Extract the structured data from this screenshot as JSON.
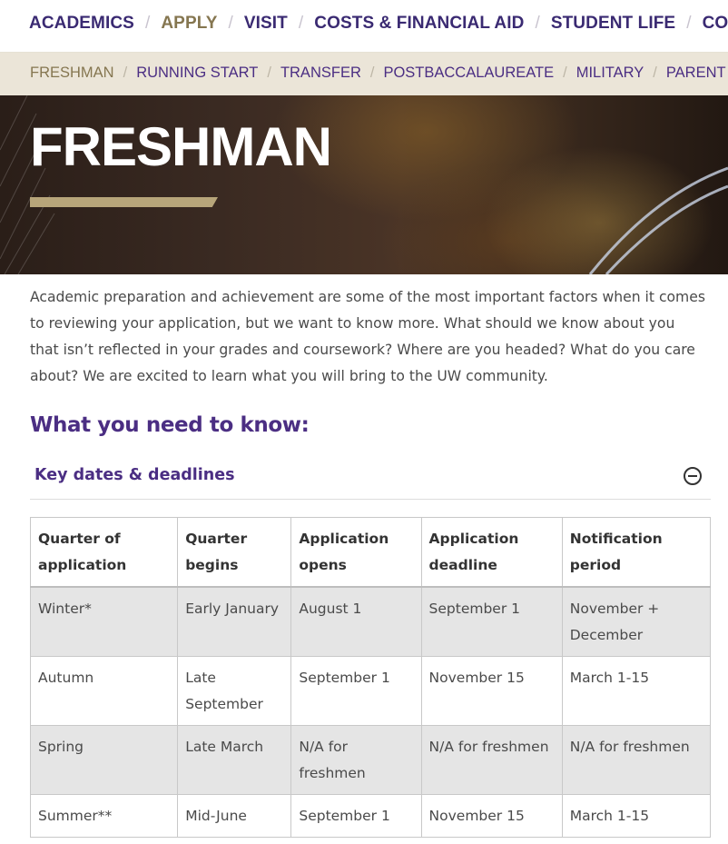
{
  "top_nav": {
    "items": [
      {
        "label": "ACADEMICS",
        "active": false
      },
      {
        "label": "APPLY",
        "active": true
      },
      {
        "label": "VISIT",
        "active": false
      },
      {
        "label": "COSTS & FINANCIAL AID",
        "active": false
      },
      {
        "label": "STUDENT LIFE",
        "active": false
      },
      {
        "label": "CON",
        "active": false
      }
    ],
    "separator": "/"
  },
  "sub_nav": {
    "items": [
      {
        "label": "FRESHMAN",
        "active": true
      },
      {
        "label": "RUNNING START",
        "active": false
      },
      {
        "label": "TRANSFER",
        "active": false
      },
      {
        "label": "POSTBACCALAUREATE",
        "active": false
      },
      {
        "label": "MILITARY",
        "active": false
      },
      {
        "label": "PARENT",
        "active": false
      }
    ],
    "separator": "/"
  },
  "hero": {
    "title": "FRESHMAN"
  },
  "intro": "Academic preparation and achievement are some of the most important factors when it comes to reviewing your application, but we want to know more. What should we know about you that isn’t reflected in your grades and coursework? Where are you headed? What do you care about? We are excited to learn what you will bring to the UW community.",
  "section_heading": "What you need to know:",
  "accordion": {
    "label": "Key dates & deadlines",
    "toggle_icon": "minus-circle-icon",
    "expanded": true
  },
  "table": {
    "headers": [
      "Quarter of application",
      "Quarter begins",
      "Application opens",
      "Application deadline",
      "Notification period"
    ],
    "rows": [
      [
        "Winter*",
        "Early January",
        "August 1",
        "September 1",
        "November + December"
      ],
      [
        "Autumn",
        "Late September",
        "September 1",
        "November 15",
        "March 1-15"
      ],
      [
        "Spring",
        "Late March",
        "N/A for freshmen",
        "N/A for freshmen",
        "N/A for freshmen"
      ],
      [
        "Summer**",
        "Mid-June",
        "September 1",
        "November 15",
        "March 1-15"
      ]
    ]
  },
  "colors": {
    "purple": "#4b2e83",
    "gold": "#857650",
    "gold_bar": "#b7a57a",
    "subnav_bg": "#ebe5d8",
    "row_shade": "#e5e5e5"
  }
}
